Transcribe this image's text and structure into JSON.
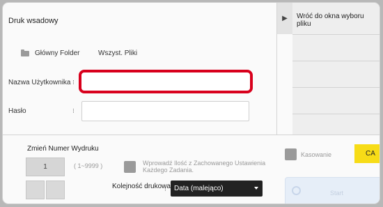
{
  "header": {
    "title": "Druk wsadowy"
  },
  "side_panel": {
    "toggle_icon": "chevron-right-icon",
    "label": "Wróć do okna wyboru pliku"
  },
  "folder": {
    "main": "Główny Folder",
    "all_files": "Wszyst. Pliki"
  },
  "form": {
    "username_label": "Nazwa Użytkownika",
    "username_value": "",
    "password_label": "Hasło",
    "password_value": "",
    "separator": "⁝"
  },
  "print_number": {
    "title": "Zmień Numer Wydruku",
    "value": "1",
    "range": "( 1~9999 )"
  },
  "options": {
    "settings_checkbox_label": "Wprowadź Ilość z Zachowanego Ustawienia Każdego Zadania.",
    "delete_label": "Kasowanie",
    "ca_label": "CA",
    "order_label": "Kolejność drukowania",
    "order_value": "Data (malejąco)",
    "start_label": "Start"
  },
  "colors": {
    "focus": "#d8001c",
    "ca": "#f7dc17",
    "select_bg": "#222222"
  }
}
